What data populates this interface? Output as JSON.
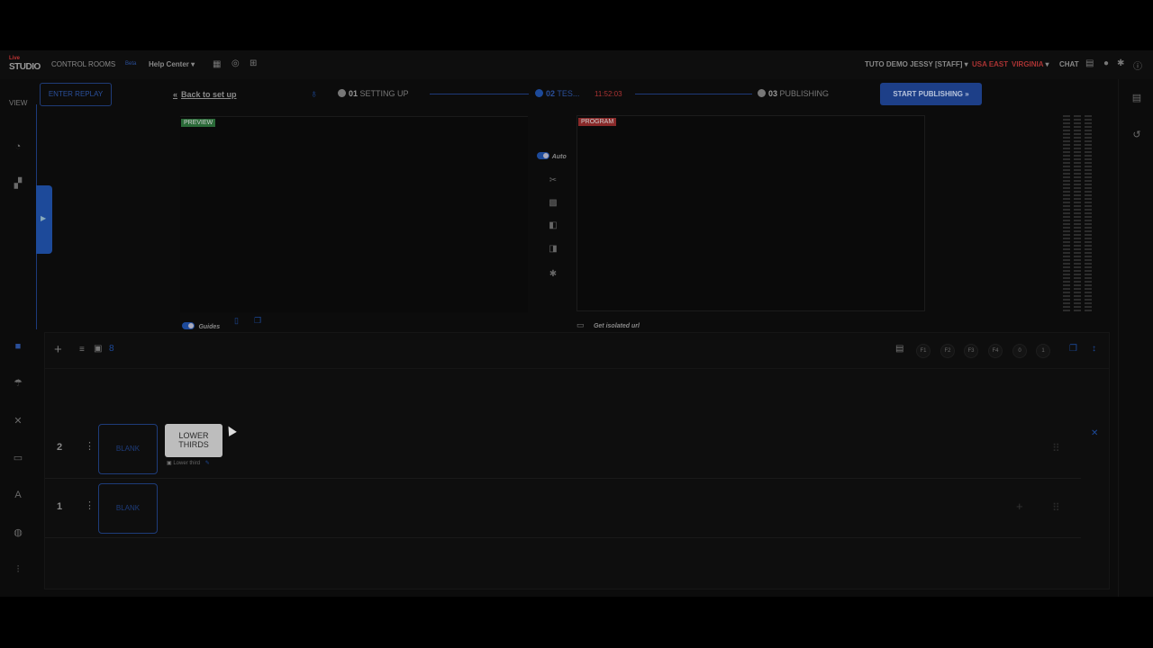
{
  "topbar": {
    "logo_top": "Live",
    "logo_main": "STUDIO",
    "control_rooms": "CONTROL ROOMS",
    "beta": "Beta",
    "help_center": "Help Center",
    "user": "TUTO DEMO JESSY [STAFF]",
    "region": "USA EAST",
    "region_sub": "VIRGINIA",
    "chat": "CHAT"
  },
  "left_rail": {
    "view_label": "VIEW"
  },
  "stepbar": {
    "enter_replay": "ENTER REPLAY",
    "back_label": "Back to set up",
    "step1_num": "01",
    "step1_label": "SETTING UP",
    "step2_num": "02",
    "step2_label": "TES...",
    "timer": "11:52:03",
    "step3_num": "03",
    "step3_label": "PUBLISHING",
    "start_publishing": "START PUBLISHING"
  },
  "preview": {
    "tag": "PREVIEW",
    "guides_label": "Guides"
  },
  "program": {
    "tag": "PROGRAM",
    "isolated_url": "Get isolated url"
  },
  "mid_controls": {
    "auto_label": "Auto"
  },
  "layers_toolbar": {
    "fkeys": [
      "F1",
      "F2",
      "F3",
      "F4",
      "0",
      "1"
    ]
  },
  "layers": [
    {
      "number": "2",
      "blank_label": "BLANK",
      "thumb_label": "LOWER THIRDS",
      "thumb_line1": "LOWER",
      "thumb_line2": "THIRDS",
      "element_name": "Lower third"
    },
    {
      "number": "1",
      "blank_label": "BLANK"
    }
  ],
  "colors": {
    "accent": "#1d4a9a",
    "live_red": "#a33333",
    "preview_green": "#2a6a38"
  }
}
